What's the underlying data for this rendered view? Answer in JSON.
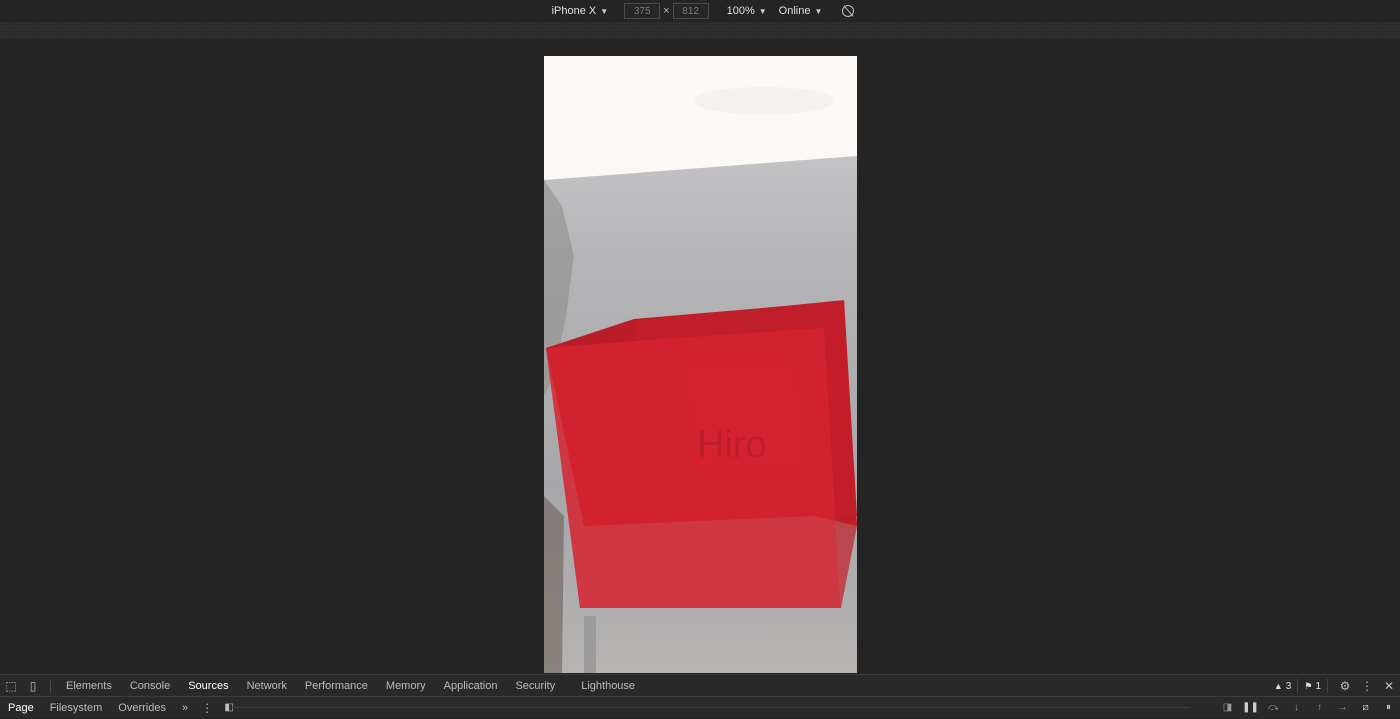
{
  "device_toolbar": {
    "device": "iPhone X",
    "width": "375",
    "height": "812",
    "times": "×",
    "zoom": "100%",
    "network": "Online"
  },
  "screen": {
    "marker_text": "Hiro",
    "cube_color": "#d61f2c"
  },
  "devtools": {
    "tabs": [
      "Elements",
      "Console",
      "Sources",
      "Network",
      "Performance",
      "Memory",
      "Application",
      "Security",
      "Lighthouse"
    ],
    "active_tab": "Sources",
    "warnings_count": "3",
    "issues_count": "1",
    "sources_nav": {
      "tabs": [
        "Page",
        "Filesystem",
        "Overrides"
      ],
      "active": "Page",
      "more": "»"
    }
  }
}
